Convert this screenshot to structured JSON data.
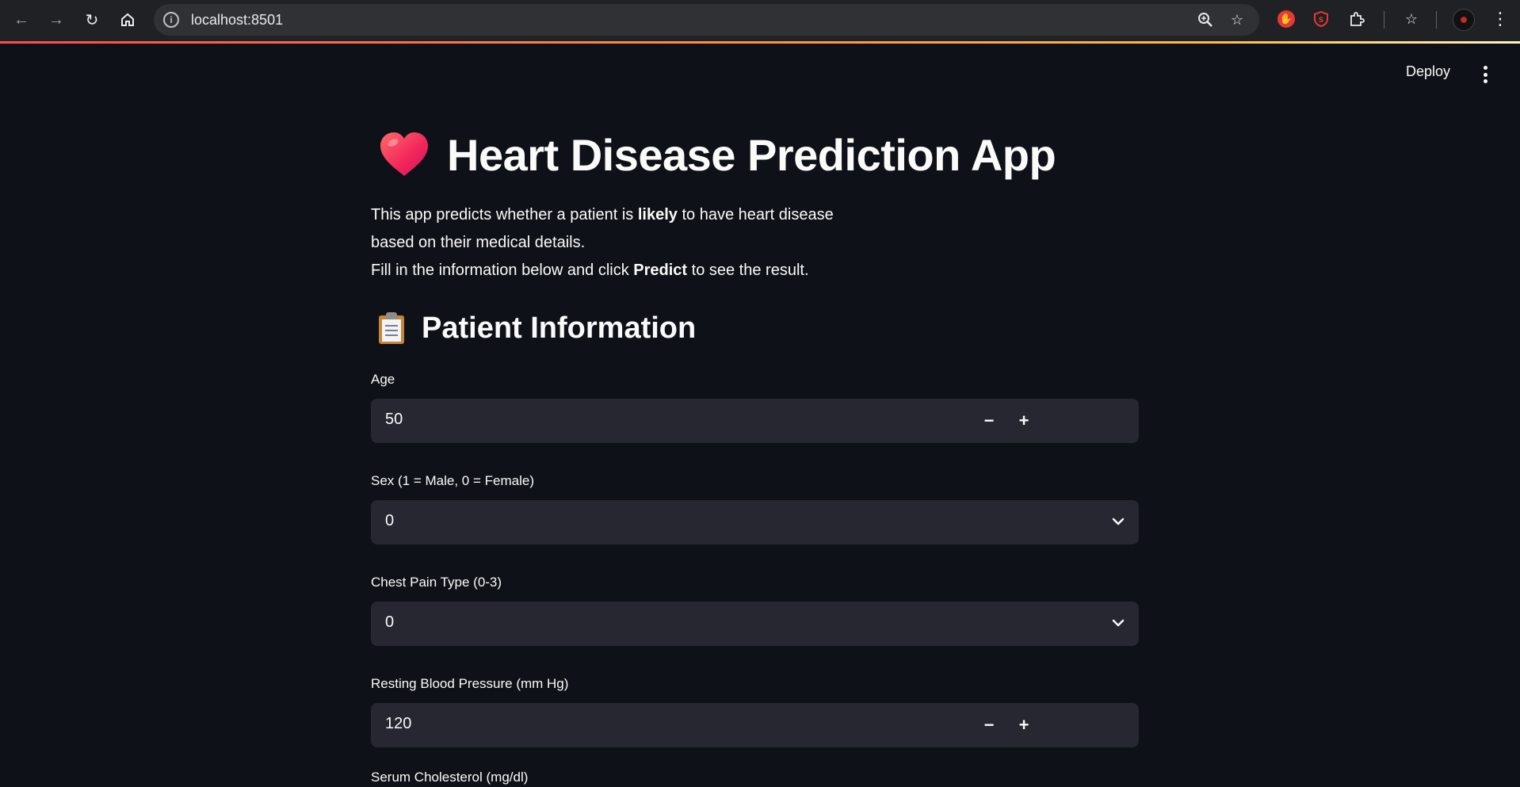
{
  "browser": {
    "url": "localhost:8501",
    "info_icon": "info-icon",
    "icons": [
      "back-arrow-icon",
      "forward-arrow-icon",
      "reload-icon",
      "home-icon",
      "zoom-icon",
      "bookmark-star-icon",
      "extension-icon",
      "bookmarks-icon",
      "profile-avatar",
      "browser-menu-icon"
    ]
  },
  "header": {
    "deploy_label": "Deploy"
  },
  "app": {
    "title": "Heart Disease Prediction App",
    "description": {
      "line1_before": "This app predicts whether a patient is ",
      "line1_bold": "likely",
      "line1_after": " to have heart disease",
      "line2": "based on their medical details.",
      "line3_before": "Fill in the information below and click ",
      "line3_bold": "Predict",
      "line3_after": " to see the result."
    },
    "section_title": "Patient Information"
  },
  "fields": [
    {
      "label": "Age",
      "value": "50",
      "type": "number"
    },
    {
      "label": "Sex (1 = Male, 0 = Female)",
      "value": "0",
      "type": "select"
    },
    {
      "label": "Chest Pain Type (0-3)",
      "value": "0",
      "type": "select"
    },
    {
      "label": "Resting Blood Pressure (mm Hg)",
      "value": "120",
      "type": "number"
    },
    {
      "label": "Serum Cholesterol (mg/dl)"
    }
  ],
  "colors": {
    "background": "#0e1117",
    "input_bg": "#262730",
    "accent": "#ff4b4b"
  }
}
